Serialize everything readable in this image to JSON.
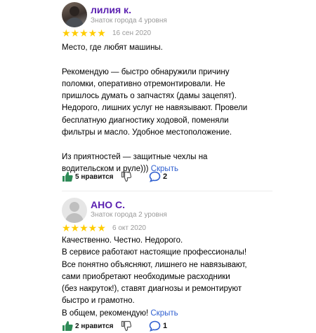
{
  "reviews": [
    {
      "name": "лилия к.",
      "level": "Знаток города 4 уровня",
      "stars": "★★★★★",
      "date": "16 сен 2020",
      "text": "Место, где любят машины.\n\nРекомендую — быстро обнаружили причину\nполомки, оперативно отремонтировали. Не\nпришлось думать о запчастях (дамы зацепят).\nНедорого, лишних услуг не навязывают. Провели\nбесплатную диагностику ходовой, поменяли\nфильтры и масло. Удобное местоположение.\n\nИз приятностей — защитные чехлы на\nводительском и руле))) ",
      "more": "Скрыть",
      "likes": "5 нравится",
      "comments": "2"
    },
    {
      "name": "АНО С.",
      "level": "Знаток города 2 уровня",
      "stars": "★★★★★",
      "date": "6 окт 2020",
      "text": "Качественно. Честно. Недорого.\nВ сервисе работают настоящие профессионалы!\nВсе понятно объясняют, лишнего не навязывают,\nсами приобретают необходимые расходники\n(без накруток!), ставят диагнозы и ремонтируют\nбыстро и грамотно.\nВ общем, рекомендую! ",
      "more": "Скрыть",
      "likes": "2 нравится",
      "comments": "1"
    }
  ],
  "colors": {
    "name": "#5a1fb0",
    "star": "#ffcc00",
    "link": "#2f5fd0",
    "like": "#2e8b57",
    "comment": "#2f5fd0",
    "meta": "#9a9a9a"
  },
  "icons": [
    "user-avatar",
    "star-icon",
    "thumb-up-icon",
    "thumb-down-icon",
    "comment-icon"
  ]
}
